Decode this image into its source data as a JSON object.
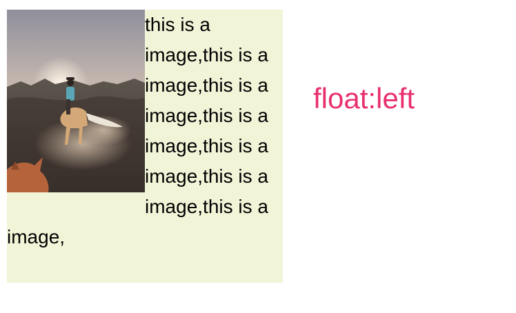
{
  "demo": {
    "paragraph": "this is a image,this is a image,this is a image,this is a image,this is a image,this is a image,this is a image,",
    "image": {
      "alt": "rider on horseback on a dusty trail at sunset",
      "icon": "photo-icon"
    }
  },
  "caption": "float:left",
  "colors": {
    "box_background": "#f2f4d8",
    "caption_color": "#e8306f",
    "text_color": "#000000"
  }
}
